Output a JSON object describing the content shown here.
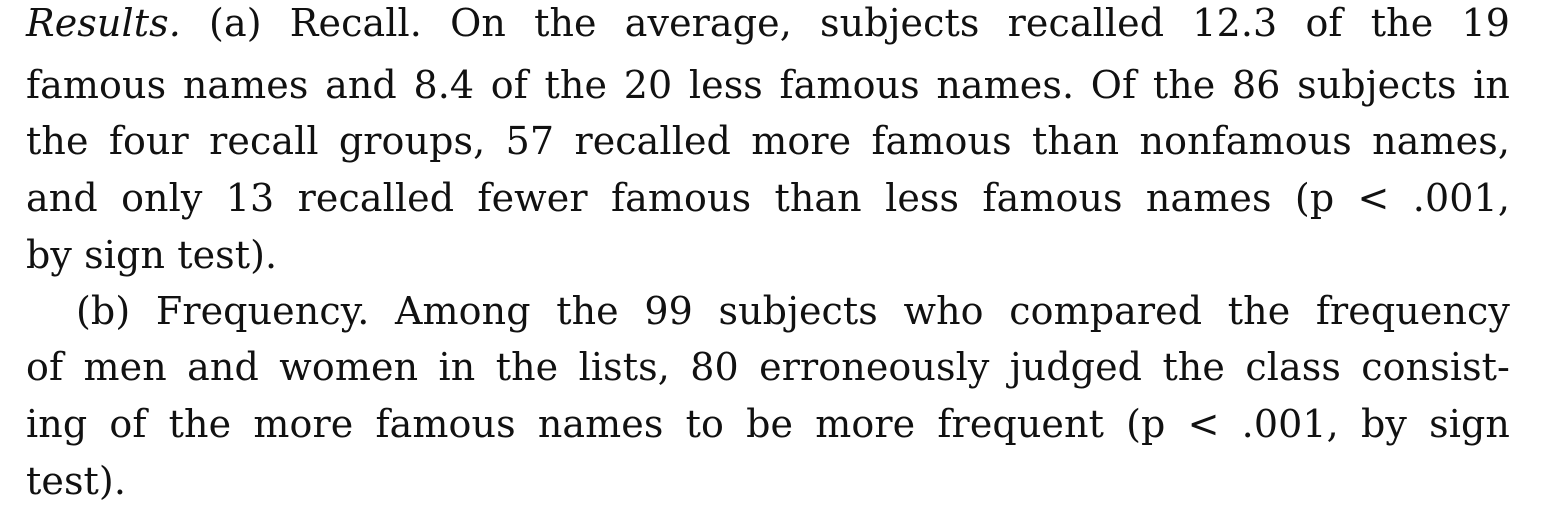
{
  "paragraphs": [
    {
      "lines": [
        {
          "lead_italic": "Results.",
          "text": " (a) Recall. On the average, subjects recalled 12.3 of the 19"
        },
        {
          "text": "famous names and 8.4 of the 20 less famous names. Of the 86 subjects in"
        },
        {
          "text": "the four recall groups, 57 recalled more famous than nonfamous names,"
        },
        {
          "text": "and only 13 recalled fewer famous than less famous names (p < .001,"
        },
        {
          "text": "by sign test)."
        }
      ]
    },
    {
      "lines": [
        {
          "text": "(b) Frequency. Among the 99 subjects who compared the frequency"
        },
        {
          "text": "of men and women in the lists, 80 erroneously judged the class consist-"
        },
        {
          "text": "ing of the more famous names to be more frequent (p < .001, by sign"
        },
        {
          "text": "test)."
        }
      ]
    }
  ]
}
